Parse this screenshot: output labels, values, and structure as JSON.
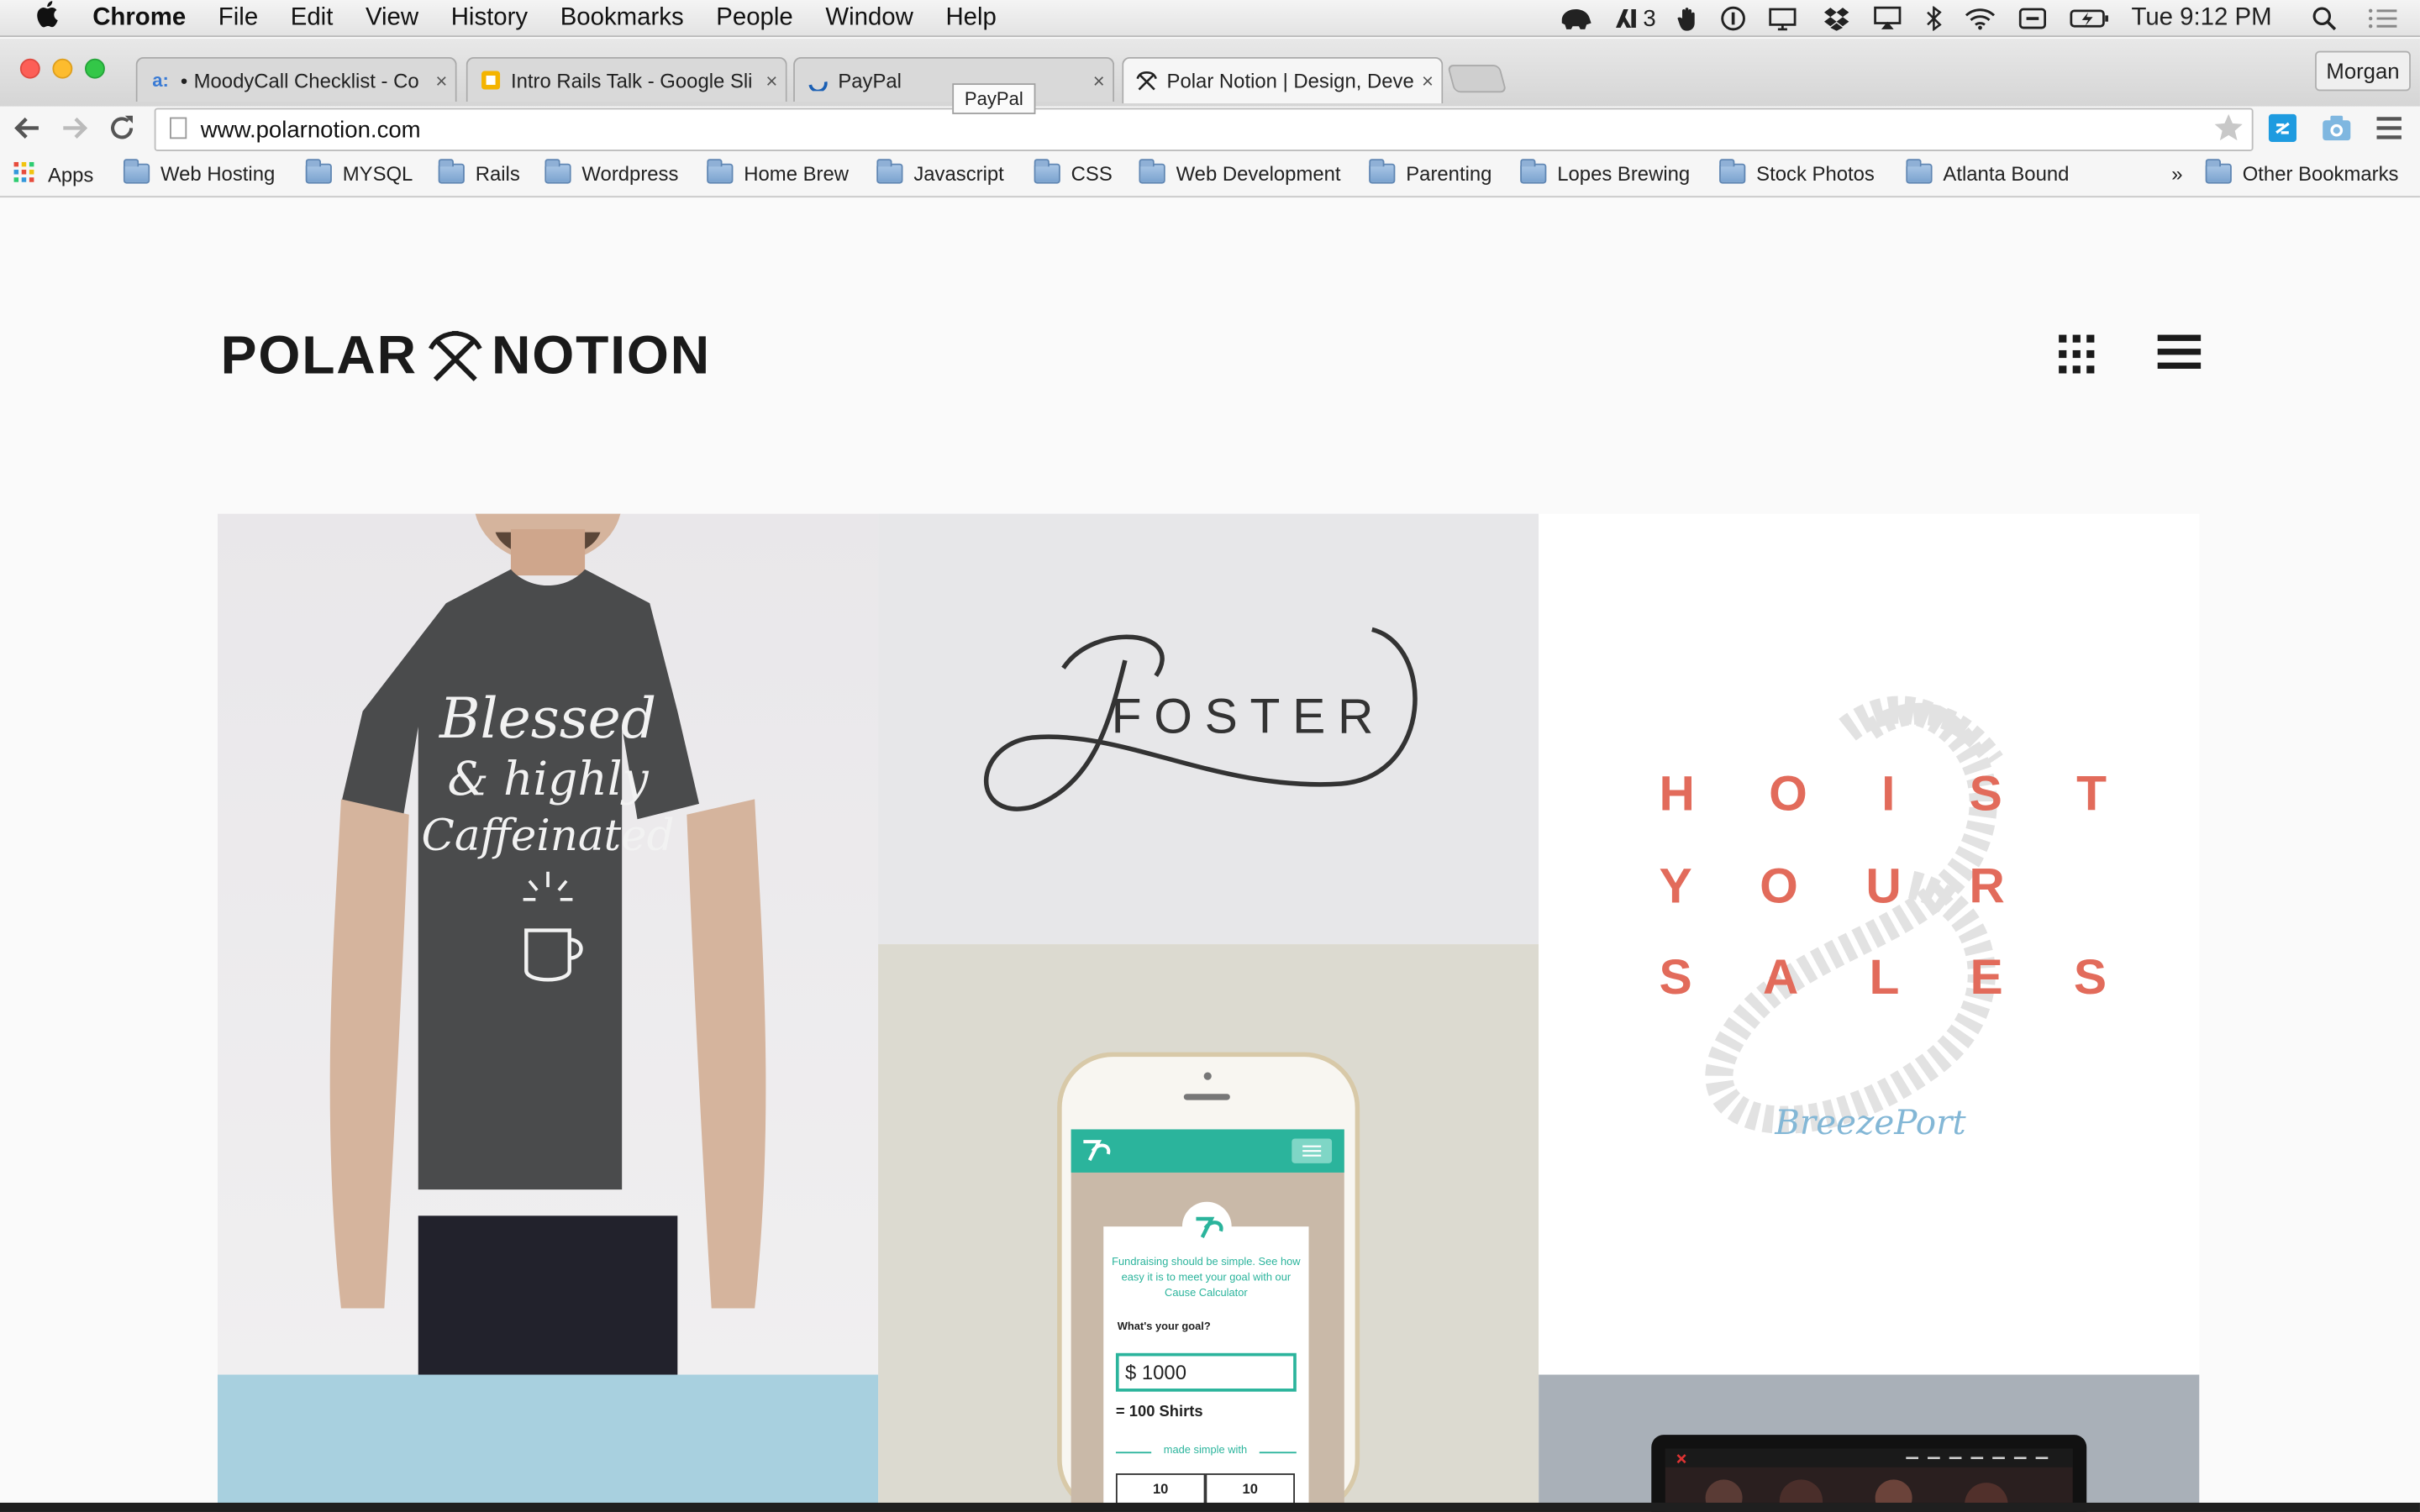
{
  "menubar": {
    "apple": "",
    "items": [
      "Chrome",
      "File",
      "Edit",
      "View",
      "History",
      "Bookmarks",
      "People",
      "Window",
      "Help"
    ],
    "tray": {
      "adobe_count": "3",
      "datetime": "Tue 9:12 PM"
    }
  },
  "tabs": [
    {
      "title": "MoodyCall Checklist - Co",
      "favicon": "a:",
      "dot": "•"
    },
    {
      "title": "Intro Rails Talk - Google Sli",
      "favicon": "slides-icon"
    },
    {
      "title": "PayPal",
      "favicon": "paypal-icon"
    },
    {
      "title": "Polar Notion | Design, Deve",
      "favicon": "pickaxe-icon"
    }
  ],
  "tab_close": "×",
  "tooltip": "PayPal",
  "profile": "Morgan",
  "toolbar": {
    "url": "www.polarnotion.com"
  },
  "bookmarks": {
    "apps_label": "Apps",
    "folders": [
      "Web Hosting",
      "MYSQL",
      "Rails",
      "Wordpress",
      "Home Brew",
      "Javascript",
      "CSS",
      "Web Development",
      "Parenting",
      "Lopes Brewing",
      "Stock Photos",
      "Atlanta Bound"
    ],
    "overflow": "»",
    "other": "Other Bookmarks"
  },
  "page": {
    "logo_left": "POLAR",
    "logo_right": "NOTION",
    "foster_text": "FOSTER",
    "shirt_text": [
      "Blessed",
      "& highly",
      "Caffeinated"
    ],
    "hoist_lines": [
      [
        "H",
        "O",
        "I",
        "S",
        "T"
      ],
      [
        "Y",
        "O",
        "U",
        "R"
      ],
      [
        "S",
        "A",
        "L",
        "E",
        "S"
      ]
    ],
    "breeze_text": "BreezePort",
    "phone": {
      "headline": "Fundraising should be simple. See how easy it is to meet your goal with our Cause Calculator",
      "question": "What's your goal?",
      "amount": "$ 1000",
      "result": "= 100 Shirts",
      "made_simple": "made simple with",
      "cell_a": "10",
      "cell_b": "10"
    }
  },
  "colors": {
    "accent_teal": "#2bb49c",
    "hoist_red": "#e26b5b",
    "blue_tile": "#a8d0df"
  }
}
